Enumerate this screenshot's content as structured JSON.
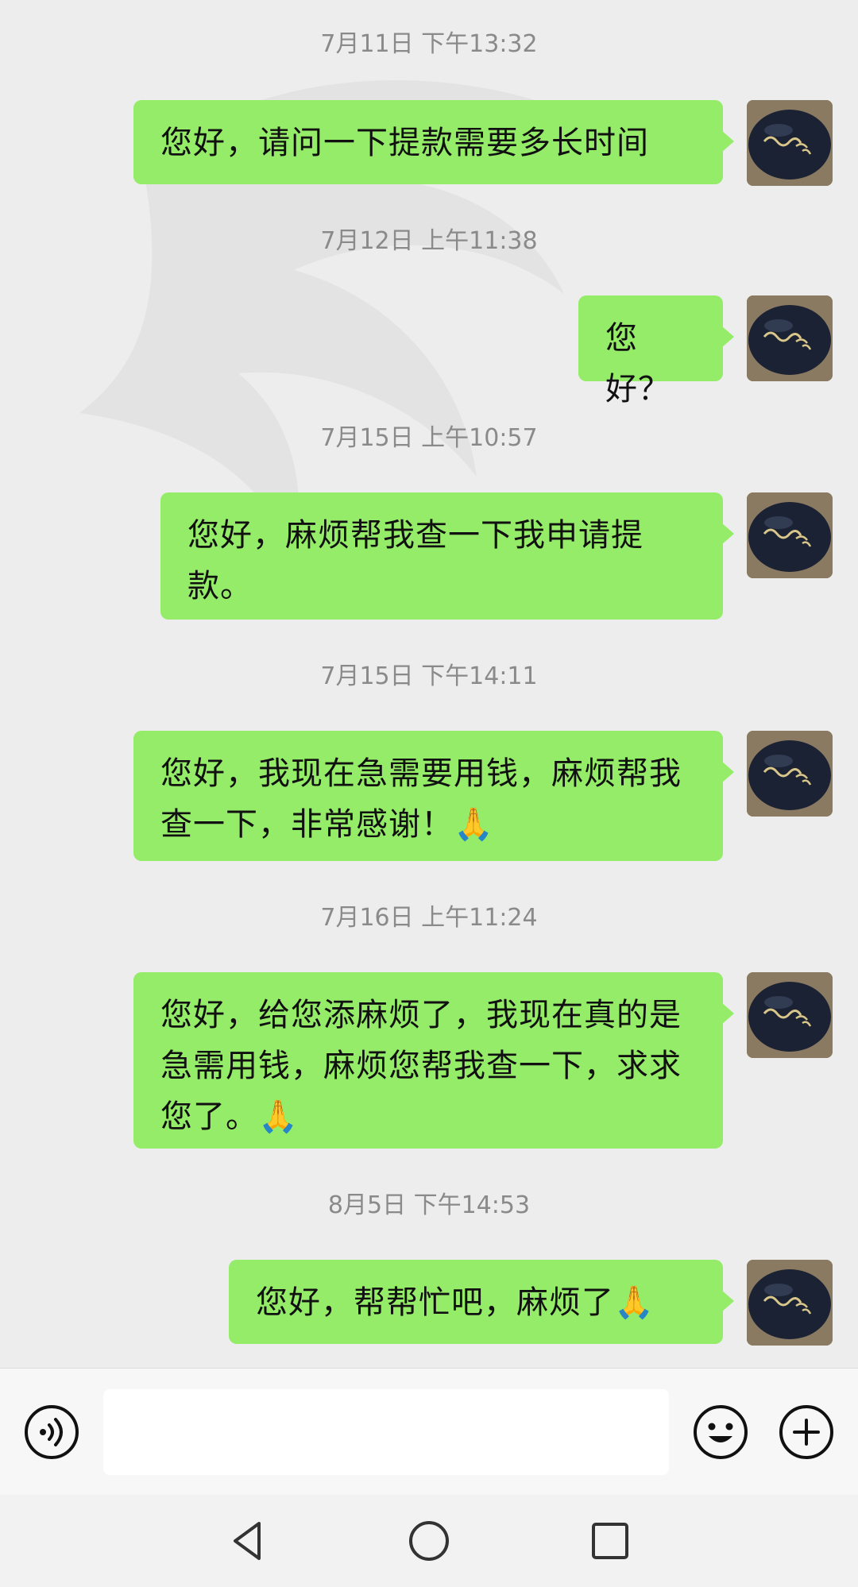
{
  "messages": [
    {
      "timestamp": "7月11日 下午13:32",
      "text": "您好，请问一下提款需要多长时间",
      "emoji": ""
    },
    {
      "timestamp": "7月12日 上午11:38",
      "text": "您好？",
      "emoji": ""
    },
    {
      "timestamp": "7月15日 上午10:57",
      "text": "您好，麻烦帮我查一下我申请提款。",
      "emoji": ""
    },
    {
      "timestamp": "7月15日 下午14:11",
      "text": "您好，我现在急需要用钱，麻烦帮我查一下，非常感谢！",
      "emoji": "🙏"
    },
    {
      "timestamp": "7月16日 上午11:24",
      "text": "您好，给您添麻烦了，我现在真的是急需用钱，麻烦您帮我查一下，求求您了。",
      "emoji": "🙏"
    },
    {
      "timestamp": "8月5日 下午14:53",
      "text": "您好，帮帮忙吧，麻烦了",
      "emoji": "🙏"
    }
  ],
  "input": {
    "placeholder": ""
  },
  "icons": {
    "voice": "voice-icon",
    "emoji": "emoji-face-icon",
    "plus": "plus-icon",
    "back": "nav-back-icon",
    "home": "nav-home-icon",
    "recents": "nav-recents-icon"
  },
  "colors": {
    "bubble": "#95ec69",
    "background": "#ededed",
    "timestamp": "#8a8a8a"
  }
}
